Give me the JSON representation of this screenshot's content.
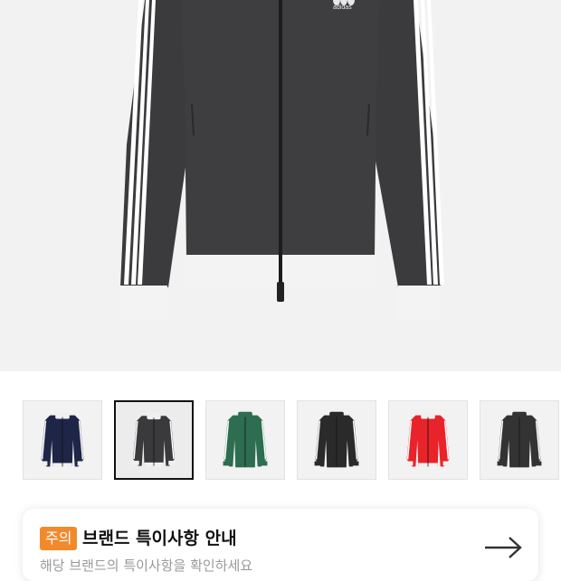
{
  "hero": {
    "product_image": "black-track-jacket-front",
    "logo_text": "adidas"
  },
  "thumbnails": [
    {
      "label": "navy",
      "body": "#1f2547",
      "collar": "#f0f0f0",
      "stripe": "#ffffff",
      "cuff": "#f0f0f0",
      "selected": false
    },
    {
      "label": "dark-grey",
      "body": "#3a3a3c",
      "collar": "#f0f0f0",
      "stripe": "#ffffff",
      "cuff": "#f0f0f0",
      "selected": true
    },
    {
      "label": "green",
      "body": "#2c6e4f",
      "collar": "#2c6e4f",
      "stripe": "#ffffff",
      "cuff": "#2c6e4f",
      "selected": false
    },
    {
      "label": "black",
      "body": "#2a2a2a",
      "collar": "#2a2a2a",
      "stripe": "#ffffff",
      "cuff": "#2a2a2a",
      "selected": false
    },
    {
      "label": "red",
      "body": "#e8232a",
      "collar": "#f0f0f0",
      "stripe": "#ffffff",
      "cuff": "#f0f0f0",
      "selected": false
    },
    {
      "label": "charcoal",
      "body": "#333333",
      "collar": "#333333",
      "stripe": "#ffffff",
      "cuff": "#333333",
      "selected": false
    }
  ],
  "notice": {
    "badge": "주의",
    "title": "브랜드 특이사항 안내",
    "subtitle": "해당 브랜드의 특이사항을 확인하세요",
    "arrow_icon": "arrow-right-icon",
    "badge_color": "#f28a2c"
  }
}
